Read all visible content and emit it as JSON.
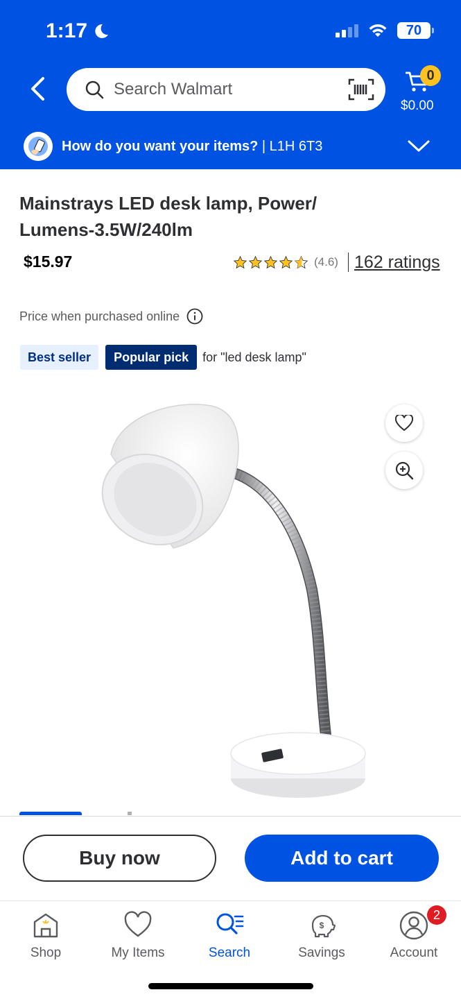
{
  "status_bar": {
    "time": "1:17",
    "battery": "70"
  },
  "header": {
    "search_placeholder": "Search Walmart",
    "cart_count": "0",
    "cart_total": "$0.00",
    "fulfillment_question": "How do you want your items?",
    "fulfillment_postal": "| L1H 6T3",
    "brand_color": "#0053e2",
    "accent_color": "#ffc220"
  },
  "product": {
    "title": "Mainstrays LED  desk lamp, Power/ Lumens-3.5W/240lm",
    "price": "$15.97",
    "rating_value": "(4.6)",
    "rating_stars": 4.6,
    "rating_count": "162 ratings",
    "price_note": "Price when purchased online",
    "badges": {
      "best_seller": "Best seller",
      "popular_pick": "Popular pick",
      "popular_for": "for \"led desk lamp\""
    }
  },
  "actions": {
    "buy_now": "Buy now",
    "add_to_cart": "Add to cart"
  },
  "nav": {
    "items": [
      {
        "label": "Shop",
        "icon": "store-icon"
      },
      {
        "label": "My Items",
        "icon": "heart-icon"
      },
      {
        "label": "Search",
        "icon": "search-list-icon"
      },
      {
        "label": "Savings",
        "icon": "piggy-bank-icon"
      },
      {
        "label": "Account",
        "icon": "user-circle-icon"
      }
    ],
    "active": "Search",
    "account_badge": "2"
  }
}
